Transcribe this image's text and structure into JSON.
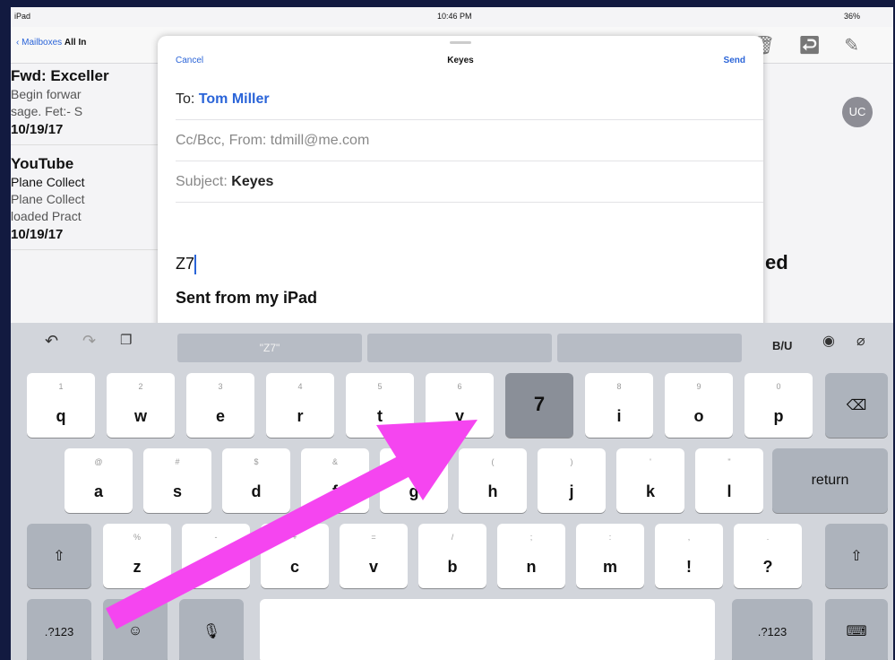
{
  "status_bar": {
    "device": "iPad",
    "time": "10:46 PM",
    "battery": "36%"
  },
  "mail_nav": {
    "back_label": "Mailboxes",
    "mailbox": "All In"
  },
  "mail_list": [
    {
      "sender": "Fwd: Exceller",
      "lines": [
        "Begin forwar",
        "sage. Fet:- S"
      ],
      "date": "10/19/17"
    },
    {
      "sender": "YouTube",
      "lines": [
        "Plane Collect",
        "Plane Collect",
        "loaded Pract"
      ],
      "date": "10/19/17"
    }
  ],
  "reading_pane": {
    "avatar_initials": "UC",
    "heading_fragment": "ed"
  },
  "compose": {
    "cancel": "Cancel",
    "title": "Keyes",
    "send": "Send",
    "to_label": "To:",
    "to_value": "Tom Miller",
    "ccbcc_label": "Cc/Bcc, From:",
    "from_value": "tdmill@me.com",
    "subject_label": "Subject:",
    "subject_value": "Keyes",
    "body_text": "Z7",
    "signature": "Sent from my iPad"
  },
  "keyboard": {
    "suggestions": [
      "\"Z7\"",
      "",
      ""
    ],
    "format_label": "B/U",
    "row1": [
      {
        "main": "q",
        "sec": "1"
      },
      {
        "main": "w",
        "sec": "2"
      },
      {
        "main": "e",
        "sec": "3"
      },
      {
        "main": "r",
        "sec": "4"
      },
      {
        "main": "t",
        "sec": "5"
      },
      {
        "main": "y",
        "sec": "6"
      },
      {
        "main": "7",
        "sec": ""
      },
      {
        "main": "i",
        "sec": "8"
      },
      {
        "main": "o",
        "sec": "9"
      },
      {
        "main": "p",
        "sec": "0"
      }
    ],
    "row2": [
      {
        "main": "a",
        "sec": "@"
      },
      {
        "main": "s",
        "sec": "#"
      },
      {
        "main": "d",
        "sec": "$"
      },
      {
        "main": "f",
        "sec": "&"
      },
      {
        "main": "g",
        "sec": "*"
      },
      {
        "main": "h",
        "sec": "("
      },
      {
        "main": "j",
        "sec": ")"
      },
      {
        "main": "k",
        "sec": "'"
      },
      {
        "main": "l",
        "sec": "\""
      }
    ],
    "row3": [
      {
        "main": "z",
        "sec": "%"
      },
      {
        "main": "x",
        "sec": "-"
      },
      {
        "main": "c",
        "sec": "+"
      },
      {
        "main": "v",
        "sec": "="
      },
      {
        "main": "b",
        "sec": "/"
      },
      {
        "main": "n",
        "sec": ";"
      },
      {
        "main": "m",
        "sec": ":"
      },
      {
        "main": "!",
        "sec": ","
      },
      {
        "main": "?",
        "sec": "."
      }
    ],
    "return_label": "return",
    "numbers_label": ".?123"
  },
  "colors": {
    "accent": "#2a64d8",
    "arrow": "#f545f0",
    "frame": "#121a40"
  }
}
